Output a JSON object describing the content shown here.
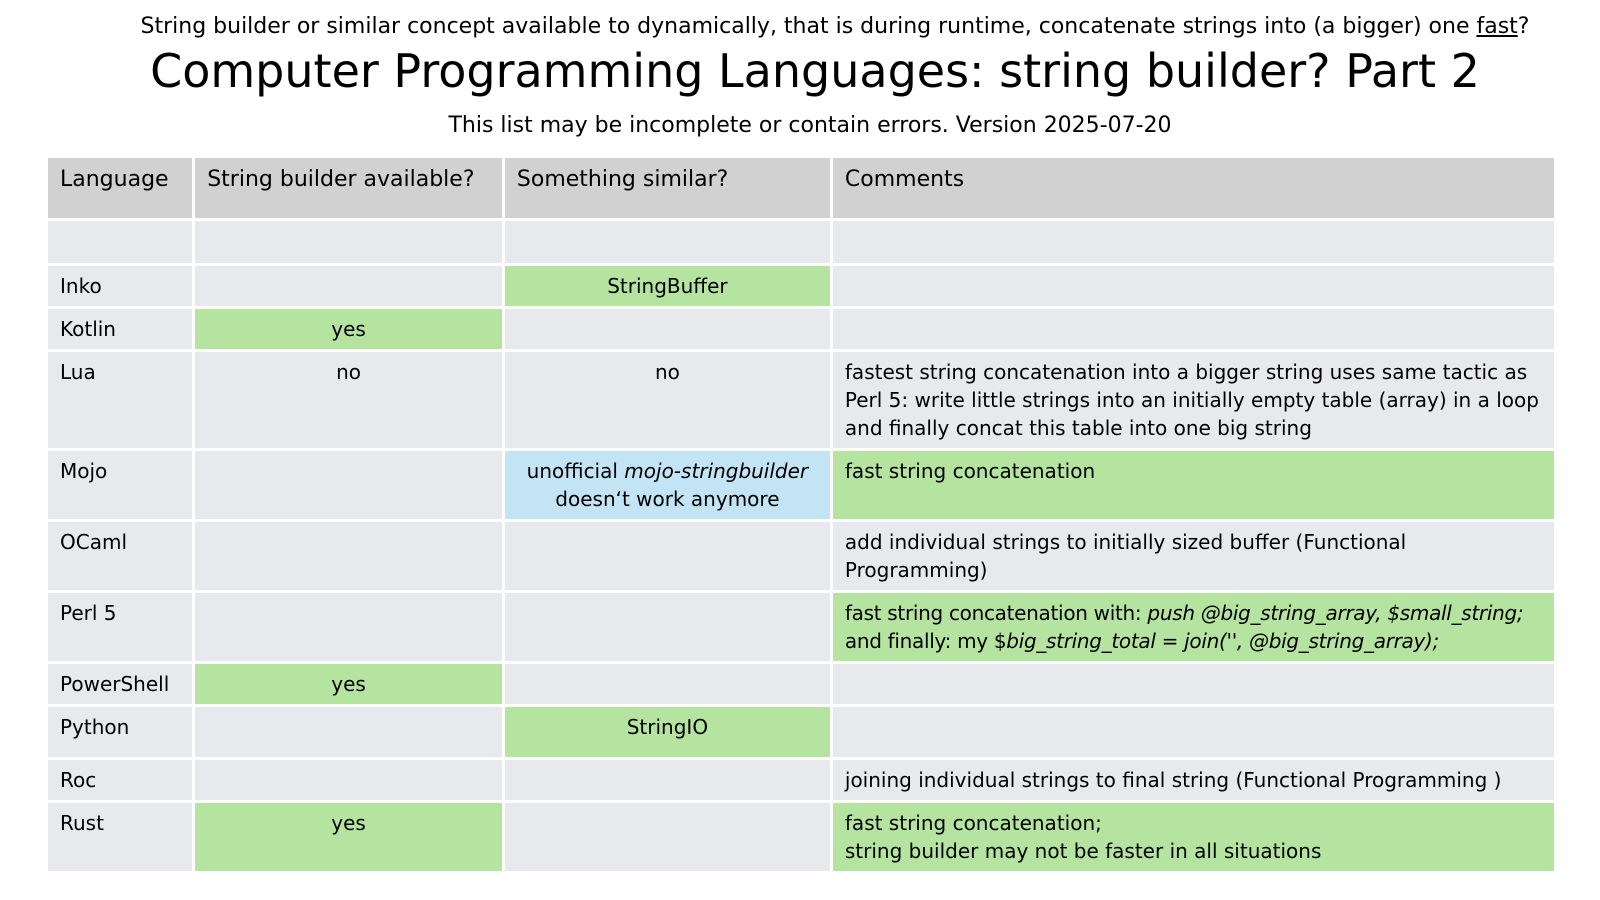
{
  "header": {
    "subtitle_before": "String builder or similar concept available to dynamically, that is during runtime, concatenate strings into (a bigger) one ",
    "subtitle_link": "fast",
    "subtitle_after": "?",
    "title": "Computer Programming Languages: string builder? Part 2",
    "version_line": "This list may be incomplete or contain errors. Version 2025-07-20"
  },
  "table": {
    "columns": [
      "Language",
      "String builder available?",
      "Something similar?",
      "Comments"
    ],
    "rows": [
      {
        "language": "",
        "builder": "",
        "similar": "",
        "comments": ""
      },
      {
        "language": "Inko",
        "builder": "",
        "similar": "StringBuffer",
        "comments": ""
      },
      {
        "language": "Kotlin",
        "builder": "yes",
        "similar": "",
        "comments": ""
      },
      {
        "language": "Lua",
        "builder": "no",
        "similar": "no",
        "comments": "fastest string concatenation into a bigger string uses same tactic as Perl 5: write little strings into an initially empty table (array) in a loop and finally concat this table into one big string"
      },
      {
        "language": "Mojo",
        "builder": "",
        "similar_prefix": "unofficial ",
        "similar_italic": "mojo-stringbuilder",
        "similar_suffix": "doesn‘t work anymore",
        "comments": "fast string concatenation"
      },
      {
        "language": "OCaml",
        "builder": "",
        "similar": "",
        "comments": "add individual strings to initially sized buffer (Functional Programming)"
      },
      {
        "language": "Perl 5",
        "builder": "",
        "similar": "",
        "comments_1": "fast string concatenation with: ",
        "comments_1_italic": "push @big_string_array, $small_string;",
        "comments_2": "and finally: my $",
        "comments_2_italic": "big_string_total = join('', @big_string_array);"
      },
      {
        "language": "PowerShell",
        "builder": "yes",
        "similar": "",
        "comments": ""
      },
      {
        "language": "Python",
        "builder": "",
        "similar": "StringIO",
        "comments": ""
      },
      {
        "language": "Roc",
        "builder": "",
        "similar": "",
        "comments": "joining individual strings to final string (Functional Programming )"
      },
      {
        "language": "Rust",
        "builder": "yes",
        "similar": "",
        "comments_1": "fast string concatenation;",
        "comments_2": "string builder may not be faster in all situations"
      }
    ]
  },
  "colors": {
    "header_bg": "#d1d1d1",
    "cell_bg": "#e7e9ec",
    "green": "#b4e4a0",
    "blue": "#c2e4f4"
  }
}
